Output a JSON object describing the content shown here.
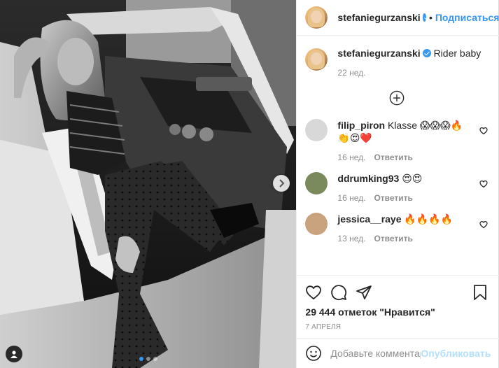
{
  "post": {
    "author": "stefaniegurzanski",
    "separator": "•",
    "follow_label": "Подписаться",
    "caption_text": "Rider baby",
    "caption_age": "22 нед.",
    "carousel_count": 3,
    "carousel_active_index": 0
  },
  "comments": [
    {
      "username": "filip_piron",
      "text": "Klasse 😱😱😱🔥👏😍❤️",
      "age": "16 нед.",
      "reply_label": "Ответить",
      "avatar_color": "#d8d8d8"
    },
    {
      "username": "ddrumking93",
      "text": "😍😍",
      "age": "16 нед.",
      "reply_label": "Ответить",
      "avatar_color": "#7b8a5c"
    },
    {
      "username": "jessica__raye",
      "text": "🔥🔥🔥🔥",
      "age": "13 нед.",
      "reply_label": "Ответить",
      "avatar_color": "#c9a27e"
    }
  ],
  "actions": {
    "likes_text": "29 444 отметок \"Нравится\"",
    "date_text": "7 апреля"
  },
  "composer": {
    "placeholder": "Добавьте комментарий...",
    "publish_label": "Опубликовать"
  },
  "icons": {
    "like": "heart-icon",
    "comment": "comment-bubble-icon",
    "share": "paper-plane-icon",
    "save": "bookmark-icon",
    "emoji": "smiley-icon",
    "load_more": "plus-circle-icon",
    "next": "chevron-right-icon",
    "tag": "user-tag-icon"
  },
  "colors": {
    "accent": "#3897f0",
    "publish_disabled": "#b2dffc",
    "muted": "#8e8e8e"
  }
}
